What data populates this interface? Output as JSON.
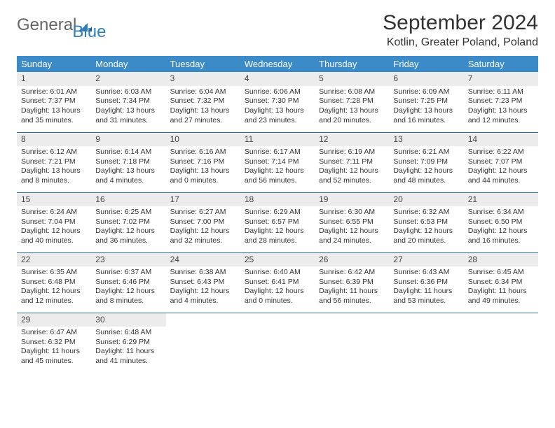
{
  "brand": {
    "part1": "General",
    "part2": "Blue"
  },
  "title": "September 2024",
  "location": "Kotlin, Greater Poland, Poland",
  "weekdays": [
    "Sunday",
    "Monday",
    "Tuesday",
    "Wednesday",
    "Thursday",
    "Friday",
    "Saturday"
  ],
  "days": [
    {
      "n": "1",
      "sr": "6:01 AM",
      "ss": "7:37 PM",
      "dl": "13 hours and 35 minutes."
    },
    {
      "n": "2",
      "sr": "6:03 AM",
      "ss": "7:34 PM",
      "dl": "13 hours and 31 minutes."
    },
    {
      "n": "3",
      "sr": "6:04 AM",
      "ss": "7:32 PM",
      "dl": "13 hours and 27 minutes."
    },
    {
      "n": "4",
      "sr": "6:06 AM",
      "ss": "7:30 PM",
      "dl": "13 hours and 23 minutes."
    },
    {
      "n": "5",
      "sr": "6:08 AM",
      "ss": "7:28 PM",
      "dl": "13 hours and 20 minutes."
    },
    {
      "n": "6",
      "sr": "6:09 AM",
      "ss": "7:25 PM",
      "dl": "13 hours and 16 minutes."
    },
    {
      "n": "7",
      "sr": "6:11 AM",
      "ss": "7:23 PM",
      "dl": "13 hours and 12 minutes."
    },
    {
      "n": "8",
      "sr": "6:12 AM",
      "ss": "7:21 PM",
      "dl": "13 hours and 8 minutes."
    },
    {
      "n": "9",
      "sr": "6:14 AM",
      "ss": "7:18 PM",
      "dl": "13 hours and 4 minutes."
    },
    {
      "n": "10",
      "sr": "6:16 AM",
      "ss": "7:16 PM",
      "dl": "13 hours and 0 minutes."
    },
    {
      "n": "11",
      "sr": "6:17 AM",
      "ss": "7:14 PM",
      "dl": "12 hours and 56 minutes."
    },
    {
      "n": "12",
      "sr": "6:19 AM",
      "ss": "7:11 PM",
      "dl": "12 hours and 52 minutes."
    },
    {
      "n": "13",
      "sr": "6:21 AM",
      "ss": "7:09 PM",
      "dl": "12 hours and 48 minutes."
    },
    {
      "n": "14",
      "sr": "6:22 AM",
      "ss": "7:07 PM",
      "dl": "12 hours and 44 minutes."
    },
    {
      "n": "15",
      "sr": "6:24 AM",
      "ss": "7:04 PM",
      "dl": "12 hours and 40 minutes."
    },
    {
      "n": "16",
      "sr": "6:25 AM",
      "ss": "7:02 PM",
      "dl": "12 hours and 36 minutes."
    },
    {
      "n": "17",
      "sr": "6:27 AM",
      "ss": "7:00 PM",
      "dl": "12 hours and 32 minutes."
    },
    {
      "n": "18",
      "sr": "6:29 AM",
      "ss": "6:57 PM",
      "dl": "12 hours and 28 minutes."
    },
    {
      "n": "19",
      "sr": "6:30 AM",
      "ss": "6:55 PM",
      "dl": "12 hours and 24 minutes."
    },
    {
      "n": "20",
      "sr": "6:32 AM",
      "ss": "6:53 PM",
      "dl": "12 hours and 20 minutes."
    },
    {
      "n": "21",
      "sr": "6:34 AM",
      "ss": "6:50 PM",
      "dl": "12 hours and 16 minutes."
    },
    {
      "n": "22",
      "sr": "6:35 AM",
      "ss": "6:48 PM",
      "dl": "12 hours and 12 minutes."
    },
    {
      "n": "23",
      "sr": "6:37 AM",
      "ss": "6:46 PM",
      "dl": "12 hours and 8 minutes."
    },
    {
      "n": "24",
      "sr": "6:38 AM",
      "ss": "6:43 PM",
      "dl": "12 hours and 4 minutes."
    },
    {
      "n": "25",
      "sr": "6:40 AM",
      "ss": "6:41 PM",
      "dl": "12 hours and 0 minutes."
    },
    {
      "n": "26",
      "sr": "6:42 AM",
      "ss": "6:39 PM",
      "dl": "11 hours and 56 minutes."
    },
    {
      "n": "27",
      "sr": "6:43 AM",
      "ss": "6:36 PM",
      "dl": "11 hours and 53 minutes."
    },
    {
      "n": "28",
      "sr": "6:45 AM",
      "ss": "6:34 PM",
      "dl": "11 hours and 49 minutes."
    },
    {
      "n": "29",
      "sr": "6:47 AM",
      "ss": "6:32 PM",
      "dl": "11 hours and 45 minutes."
    },
    {
      "n": "30",
      "sr": "6:48 AM",
      "ss": "6:29 PM",
      "dl": "11 hours and 41 minutes."
    }
  ],
  "labels": {
    "sunrise": "Sunrise:",
    "sunset": "Sunset:",
    "daylight": "Daylight:"
  }
}
